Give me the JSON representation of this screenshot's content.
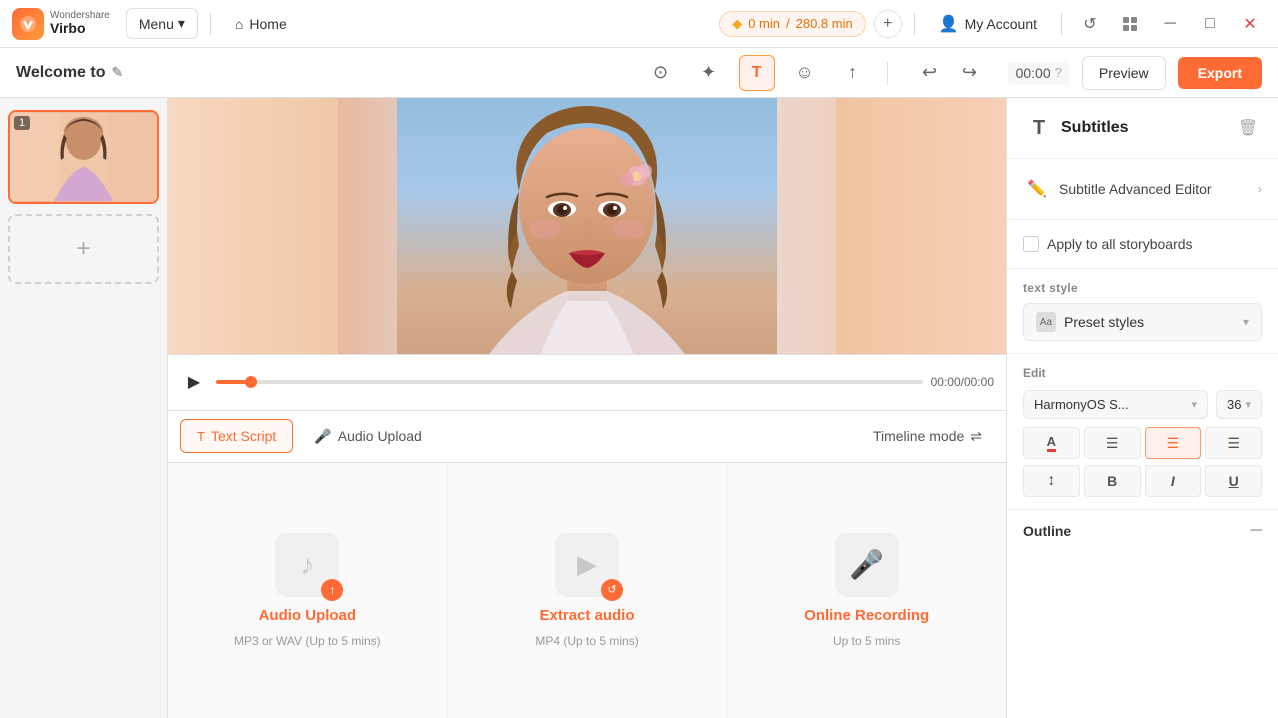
{
  "app": {
    "brand": "Wondershare",
    "product": "Virbo",
    "logo_letter": "V"
  },
  "topbar": {
    "menu_label": "Menu",
    "home_label": "Home",
    "time_used": "0 min",
    "time_total": "280.8 min",
    "add_label": "+",
    "account_label": "My Account"
  },
  "toolbar": {
    "title": "Welcome to",
    "edit_icon": "✎",
    "time_display": "00:00",
    "preview_label": "Preview",
    "export_label": "Export"
  },
  "storyboard": {
    "item_num": "1",
    "add_label": "+"
  },
  "timeline": {
    "time_display": "00:00/00:00"
  },
  "tabs": {
    "text_script_label": "Text Script",
    "audio_upload_label": "Audio Upload",
    "timeline_mode_label": "Timeline mode"
  },
  "upload_options": [
    {
      "id": "audio-upload",
      "title": "Audio Upload",
      "subtitle": "MP3 or WAV (Up to 5 mins)",
      "badge_type": "up",
      "color": "#ff6b35"
    },
    {
      "id": "extract-audio",
      "title": "Extract audio",
      "subtitle": "MP4 (Up to 5 mins)",
      "badge_type": "refresh",
      "color": "#ff6b35"
    },
    {
      "id": "online-recording",
      "title": "Online Recording",
      "subtitle": "Up to 5 mins",
      "badge_type": "mic",
      "color": "#ff6b35"
    }
  ],
  "right_panel": {
    "header_icon": "T",
    "header_title": "Subtitles",
    "subtitle_advanced_editor_label": "Subtitle Advanced Editor",
    "apply_to_all_label": "Apply to all storyboards",
    "text_style_label": "text style",
    "preset_styles_label": "Preset styles",
    "edit_label": "Edit",
    "font_name": "HarmonyOS S...",
    "font_size": "36",
    "align_left": "≡",
    "align_center": "≡",
    "align_right_active": "≡",
    "align_justify": "≡",
    "format_line_height": "↕",
    "format_bold": "B",
    "format_italic": "I",
    "format_underline": "U",
    "outline_label": "Outline"
  }
}
